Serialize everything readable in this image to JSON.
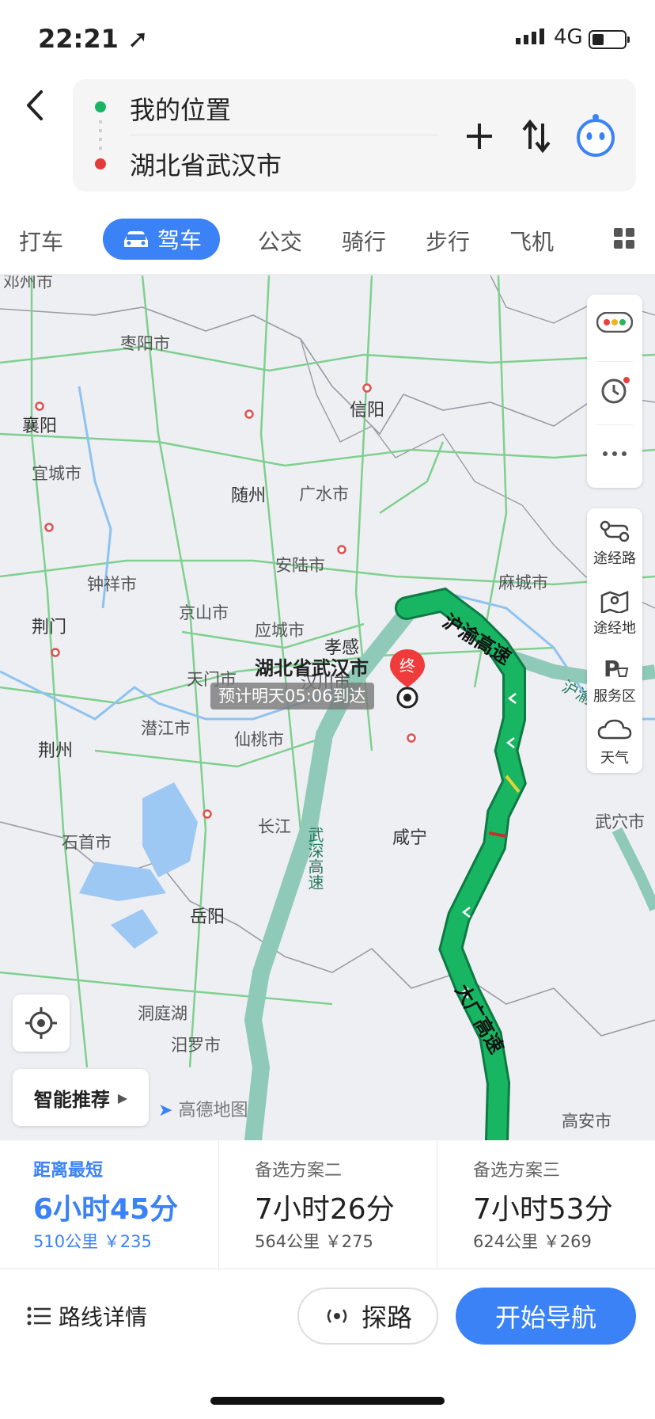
{
  "status": {
    "time": "22:21",
    "network": "4G"
  },
  "route": {
    "from": "我的位置",
    "to": "湖北省武汉市"
  },
  "modes": {
    "taxi": "打车",
    "drive": "驾车",
    "bus": "公交",
    "bike": "骑行",
    "walk": "步行",
    "plane": "飞机"
  },
  "map": {
    "cities": [
      {
        "name": "邓州市"
      },
      {
        "name": "枣阳市"
      },
      {
        "name": "襄阳"
      },
      {
        "name": "信阳"
      },
      {
        "name": "宜城市"
      },
      {
        "name": "随州"
      },
      {
        "name": "广水市"
      },
      {
        "name": "安陆市"
      },
      {
        "name": "钟祥市"
      },
      {
        "name": "麻城市"
      },
      {
        "name": "京山市"
      },
      {
        "name": "荆门"
      },
      {
        "name": "应城市"
      },
      {
        "name": "孝感"
      },
      {
        "name": "天门市"
      },
      {
        "name": "汉川市"
      },
      {
        "name": "潜江市"
      },
      {
        "name": "仙桃市"
      },
      {
        "name": "荆州"
      },
      {
        "name": "长江"
      },
      {
        "name": "咸宁"
      },
      {
        "name": "武穴市"
      },
      {
        "name": "石首市"
      },
      {
        "name": "岳阳"
      },
      {
        "name": "洞庭湖"
      },
      {
        "name": "汨罗市"
      },
      {
        "name": "高安市"
      }
    ],
    "destination_label": "湖北省武汉市",
    "end_marker": "终",
    "eta_text": "预计明天05:06到达",
    "roads": {
      "huyu": "沪渝高速",
      "huyu2": "沪渝高速",
      "wushen": "武深高速",
      "daguang": "大广高速"
    },
    "logo": "高德地图"
  },
  "side_panel": {
    "route_via": "途经路",
    "via_point": "途经地",
    "service": "服务区",
    "weather": "天气"
  },
  "smart_recommend": "智能推荐",
  "plans": [
    {
      "label": "距离最短",
      "duration": "6小时45分",
      "distance": "510公里",
      "cost": "￥235"
    },
    {
      "label": "备选方案二",
      "duration": "7小时26分",
      "distance": "564公里",
      "cost": "￥275"
    },
    {
      "label": "备选方案三",
      "duration": "7小时53分",
      "distance": "624公里",
      "cost": "￥269"
    }
  ],
  "actions": {
    "details": "路线详情",
    "explore": "探路",
    "start": "开始导航"
  },
  "colors": {
    "accent": "#3b82f6",
    "route": "#17a55e",
    "road": "#8fc9b7"
  }
}
